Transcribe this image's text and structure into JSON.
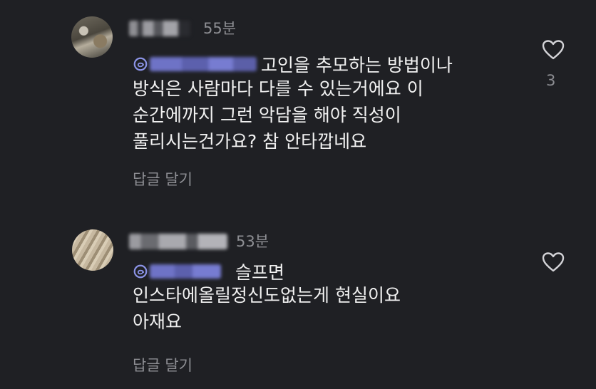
{
  "comments": [
    {
      "time": "55분",
      "first_line": "고인을 추모하는 방법이나",
      "lines": [
        "방식은 사람마다 다를 수 있는거에요 이",
        "순간에까지 그런 악담을 해야 직성이",
        "풀리시는건가요? 참 안타깝네요"
      ],
      "reply_label": "답글 달기",
      "like_count": "3"
    },
    {
      "time": "53분",
      "first_line": "슬프면",
      "lines": [
        "인스타에올릴정신도없는게 현실이요",
        "아재요"
      ],
      "reply_label": "답글 달기"
    }
  ],
  "colors": {
    "background": "#1f2024",
    "text": "#f1f1f1",
    "muted": "#8d8e93",
    "mention": "#8b93e6"
  }
}
